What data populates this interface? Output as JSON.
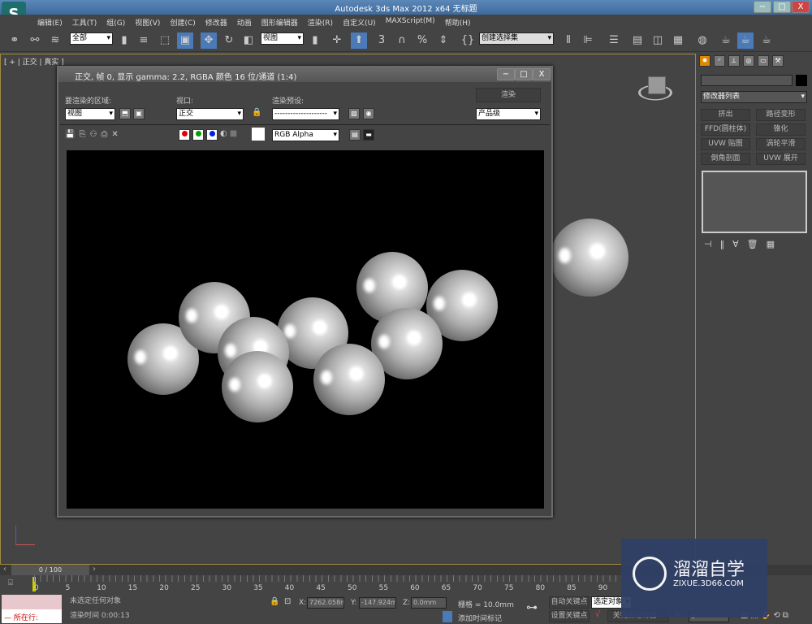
{
  "app": {
    "title": "Autodesk 3ds Max  2012 x64    无标题",
    "logo": "S"
  },
  "window_controls": [
    "−",
    "□",
    "X"
  ],
  "menu": [
    "编辑(E)",
    "工具(T)",
    "组(G)",
    "视图(V)",
    "创建(C)",
    "修改器",
    "动画",
    "图形编辑器",
    "渲染(R)",
    "自定义(U)",
    "MAXScript(M)",
    "帮助(H)"
  ],
  "toolbar": {
    "selection_filter": "全部",
    "ref_coord": "视图",
    "named_sel": "创建选择集",
    "snap_labels": [
      "3",
      "%"
    ]
  },
  "viewport": {
    "label": "[ + | 正交 | 真实 ]"
  },
  "render_window": {
    "title": "正交, 帧 0, 显示 gamma: 2.2, RGBA 颜色 16 位/通道 (1:4)",
    "area_label": "要渲染的区域:",
    "area_value": "视图",
    "viewport_label": "视口:",
    "viewport_value": "正交",
    "preset_label": "渲染预设:",
    "preset_value": "--------------------",
    "render_button": "渲染",
    "quality_value": "产品级",
    "channel_value": "RGB Alpha",
    "channel_colors": [
      "#e00000",
      "#00a000",
      "#0020e0"
    ]
  },
  "command_panel": {
    "tabs": [
      "create-icon",
      "modify-icon",
      "hierarchy-icon",
      "motion-icon",
      "display-icon",
      "utilities-icon"
    ],
    "modifier_list": "修改器列表",
    "buttons": [
      "挤出",
      "路径变形",
      "FFD(圆柱体)",
      "锥化",
      "UVW 贴图",
      "涡轮平滑",
      "倒角剖面",
      "UVW 展开"
    ]
  },
  "timeline": {
    "frame": "0 / 100",
    "ticks": [
      "0",
      "5",
      "10",
      "15",
      "20",
      "25",
      "30",
      "35",
      "40",
      "45",
      "50",
      "55",
      "60",
      "65",
      "70",
      "75",
      "80",
      "85",
      "90"
    ]
  },
  "status": {
    "script_label": "所在行:",
    "selection": "未选定任何对象",
    "render_time": "渲染时间  0:00:13",
    "x_label": "X:",
    "x": "7262.058m",
    "y_label": "Y:",
    "y": "-147.924m",
    "z_label": "Z:",
    "z": "0.0mm",
    "grid": "栅格 = 10.0mm",
    "add_tag": "添加时间标记",
    "auto_key": "自动关键点",
    "selected": "选定对象",
    "set_key": "设置关键点",
    "key_filter": "关键点过滤器...",
    "frame_field": "0"
  },
  "watermark": {
    "brand": "溜溜自学",
    "url": "ZIXUE.3D66.COM"
  }
}
